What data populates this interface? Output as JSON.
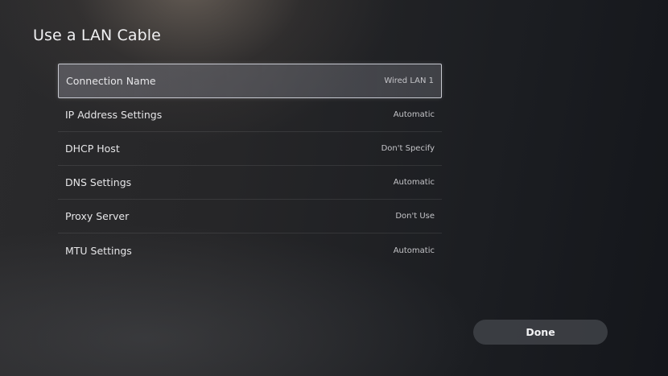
{
  "page": {
    "title": "Use a LAN Cable"
  },
  "settings": {
    "rows": [
      {
        "label": "Connection Name",
        "value": "Wired LAN 1"
      },
      {
        "label": "IP Address Settings",
        "value": "Automatic"
      },
      {
        "label": "DHCP Host",
        "value": "Don't Specify"
      },
      {
        "label": "DNS Settings",
        "value": "Automatic"
      },
      {
        "label": "Proxy Server",
        "value": "Don't Use"
      },
      {
        "label": "MTU Settings",
        "value": "Automatic"
      }
    ]
  },
  "actions": {
    "done_label": "Done"
  }
}
